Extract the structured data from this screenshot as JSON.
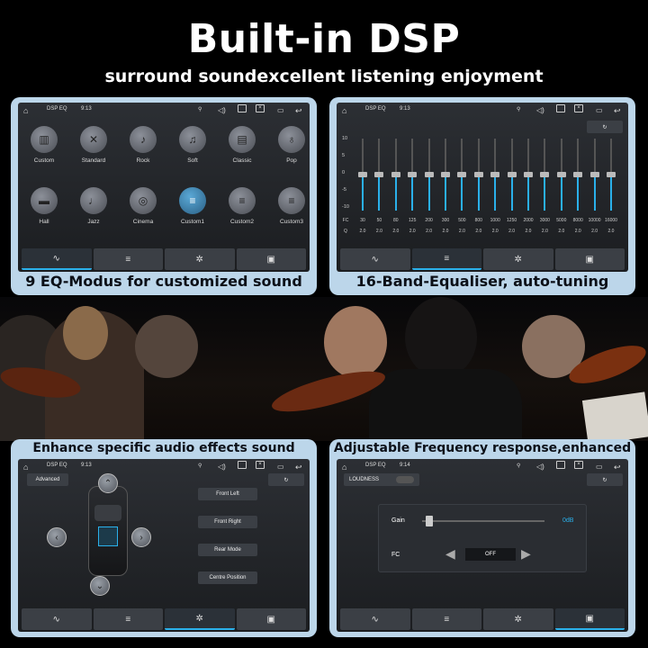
{
  "headline": "Built-in DSP",
  "subhead": "surround soundexcellent listening enjoyment",
  "status": {
    "title": "DSP EQ",
    "time_a": "9:13",
    "time_b": "9:14"
  },
  "colors": {
    "panel": "#bcd6ea",
    "accent": "#2ab0ea",
    "screen": "#1d1f22"
  },
  "panel1": {
    "caption": "9 EQ-Modus for customized sound",
    "presets": [
      {
        "label": "Custom",
        "icon": "piano-icon"
      },
      {
        "label": "Standard",
        "icon": "tools-icon"
      },
      {
        "label": "Rock",
        "icon": "guitar-icon"
      },
      {
        "label": "Soft",
        "icon": "music-note-icon"
      },
      {
        "label": "Classic",
        "icon": "piano-keys-icon"
      },
      {
        "label": "Pop",
        "icon": "microphone-icon"
      },
      {
        "label": "Hall",
        "icon": "sofa-icon"
      },
      {
        "label": "Jazz",
        "icon": "saxophone-icon"
      },
      {
        "label": "Cinema",
        "icon": "film-reel-icon"
      },
      {
        "label": "Custom1",
        "icon": "sliders-icon"
      },
      {
        "label": "Custom2",
        "icon": "sliders-icon"
      },
      {
        "label": "Custom3",
        "icon": "sliders-icon"
      }
    ],
    "selected": "Custom1"
  },
  "panel2": {
    "caption": "16-Band-Equaliser, auto-tuning",
    "yticks": [
      "10",
      "5",
      "0",
      "-5",
      "-10"
    ],
    "fc_label": "FC",
    "q_label": "Q",
    "bands": [
      {
        "fc": "30",
        "q": "2.0",
        "gain": 0
      },
      {
        "fc": "50",
        "q": "2.0",
        "gain": 0
      },
      {
        "fc": "80",
        "q": "2.0",
        "gain": 0
      },
      {
        "fc": "125",
        "q": "2.0",
        "gain": 0
      },
      {
        "fc": "200",
        "q": "2.0",
        "gain": 0
      },
      {
        "fc": "300",
        "q": "2.0",
        "gain": 0
      },
      {
        "fc": "500",
        "q": "2.0",
        "gain": 0
      },
      {
        "fc": "800",
        "q": "2.0",
        "gain": 0
      },
      {
        "fc": "1000",
        "q": "2.0",
        "gain": 0
      },
      {
        "fc": "1250",
        "q": "2.0",
        "gain": 0
      },
      {
        "fc": "2000",
        "q": "2.0",
        "gain": 0
      },
      {
        "fc": "3000",
        "q": "2.0",
        "gain": 0
      },
      {
        "fc": "5000",
        "q": "2.0",
        "gain": 0
      },
      {
        "fc": "8000",
        "q": "2.0",
        "gain": 0
      },
      {
        "fc": "10000",
        "q": "2.0",
        "gain": 0
      },
      {
        "fc": "16000",
        "q": "2.0",
        "gain": 0
      }
    ]
  },
  "panel3": {
    "caption": "Enhance specific audio effects sound quality",
    "advanced": "Advanced",
    "buttons": [
      "Front Left",
      "Front Right",
      "Rear Mode",
      "Centre Position"
    ]
  },
  "panel4": {
    "caption": "Adjustable Frequency response,enhanced",
    "loudness": "LOUDNESS",
    "gain_label": "Gain",
    "gain_value": "0dB",
    "fc_label": "FC",
    "fc_value": "OFF"
  }
}
